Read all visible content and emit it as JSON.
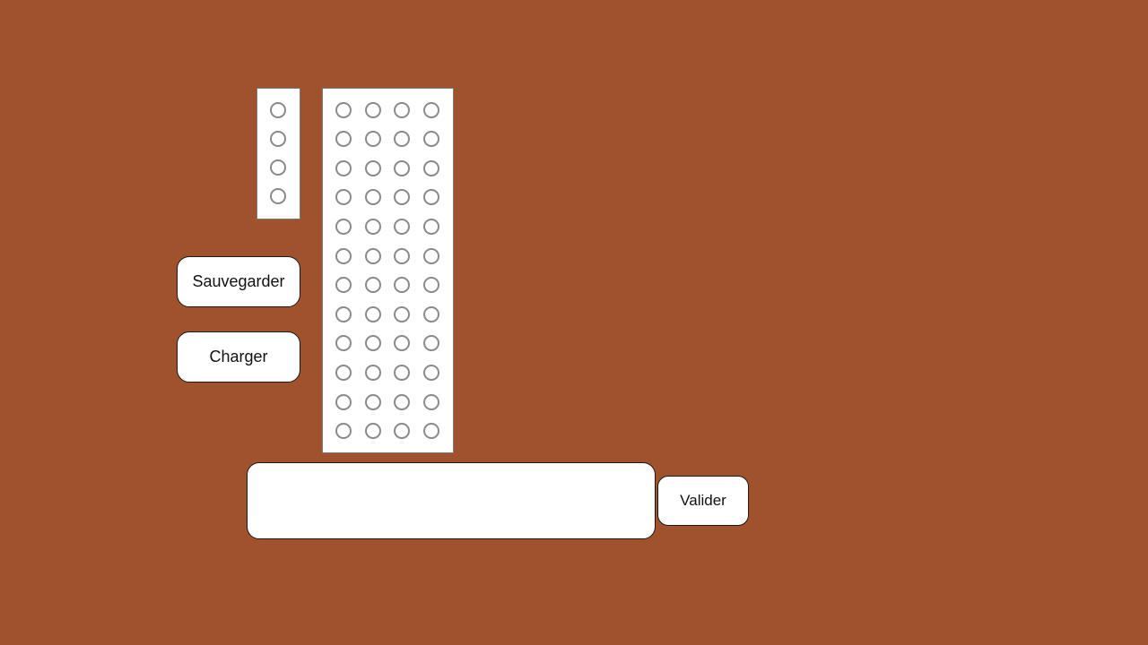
{
  "app": {
    "background_color": "#A0522D"
  },
  "solution_row": {
    "peg_count": 4,
    "peg_states": [
      "empty",
      "empty",
      "empty",
      "empty"
    ]
  },
  "board": {
    "rows": 12,
    "columns": 4,
    "peg_states": "all-empty"
  },
  "buttons": {
    "save_label": "Sauvegarder",
    "load_label": "Charger",
    "validate_label": "Valider"
  },
  "message_box": {
    "text": ""
  }
}
